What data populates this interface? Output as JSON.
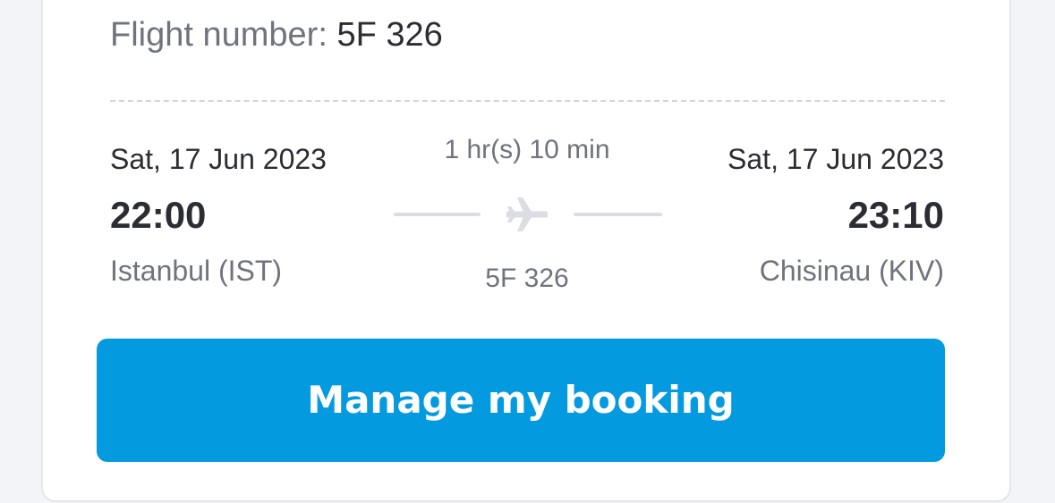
{
  "flight_header": {
    "label": "Flight number:",
    "value": "5F 326"
  },
  "departure": {
    "date": "Sat, 17 Jun 2023",
    "time": "22:00",
    "airport": "Istanbul (IST)"
  },
  "arrival": {
    "date": "Sat, 17 Jun 2023",
    "time": "23:10",
    "airport": "Chisinau (KIV)"
  },
  "route": {
    "duration": "1 hr(s) 10 min",
    "flight_number": "5F 326",
    "icon": "airplane-icon"
  },
  "actions": {
    "manage_label": "Manage my booking"
  },
  "colors": {
    "accent": "#049ae0",
    "text_primary": "#2b2d33",
    "text_secondary": "#70737e",
    "route_line": "#dcdde3"
  }
}
